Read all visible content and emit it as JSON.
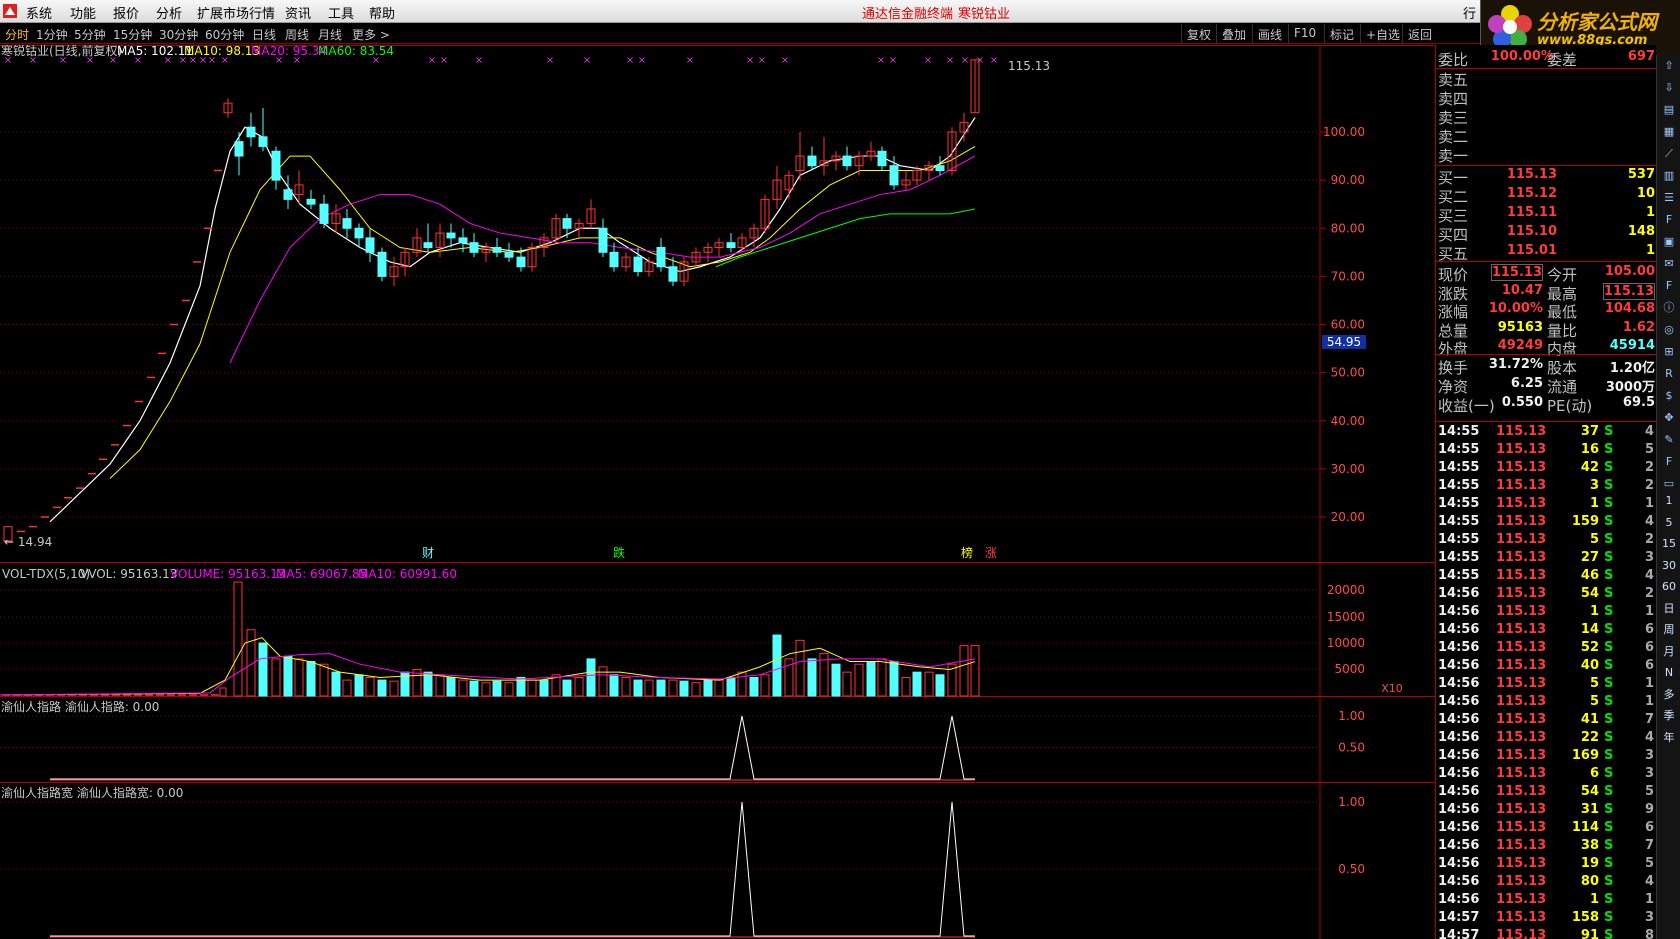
{
  "menu": {
    "items": [
      "系统",
      "功能",
      "报价",
      "分析",
      "扩展市场行情",
      "资讯",
      "工具",
      "帮助"
    ],
    "center_left": "通达信金融终端",
    "center_right": "寒锐钴业",
    "right_cut": "行"
  },
  "brand": {
    "name": "分析家公式网",
    "url": "www.88gs.com"
  },
  "periods": [
    "分时",
    "1分钟",
    "5分钟",
    "15分钟",
    "30分钟",
    "60分钟",
    "日线",
    "周线",
    "月线",
    "更多 >"
  ],
  "active_period": "分时",
  "toolbar_right": [
    "复权",
    "叠加",
    "画线",
    "F10",
    "标记",
    "+自选",
    "返回"
  ],
  "main": {
    "title": "寒锐钴业(日线,前复权)",
    "ma": [
      {
        "label": "MA5: 102.11",
        "color": "#ffffff"
      },
      {
        "label": "MA10: 98.13",
        "color": "#ffff00"
      },
      {
        "label": "MA20: 95.34",
        "color": "#ff00ff"
      },
      {
        "label": "MA60: 83.54",
        "color": "#00ff00"
      }
    ],
    "high_label": "115.13",
    "low_label": "14.94",
    "price_axis": [
      "100.00",
      "90.00",
      "80.00",
      "70.00",
      "60.00",
      "50.00",
      "40.00",
      "30.00",
      "20.00"
    ],
    "cursor_price": "54.95",
    "markers": [
      {
        "text": "财",
        "color": "#5fffff"
      },
      {
        "text": "跌",
        "color": "#00ff00"
      },
      {
        "text": "榜",
        "color": "#ffff00"
      },
      {
        "text": "涨",
        "color": "#ff4040"
      }
    ],
    "colors": {
      "up": "#ff3232",
      "down": "#54ffff",
      "ma5": "#ffffff",
      "ma10": "#ffff00",
      "ma20": "#ff00ff",
      "ma60": "#00ff00"
    }
  },
  "volume": {
    "header": [
      "VOL-TDX(5,10)",
      "VVOL: 95163.13",
      "VOLUME: 95163.13",
      "MA5: 69067.85",
      "MA10: 60991.60"
    ],
    "axis": [
      "20000",
      "15000",
      "10000",
      "5000"
    ],
    "unit": "X10"
  },
  "ind1": {
    "header": "渝仙人指路  渝仙人指路: 0.00",
    "axis": [
      "1.00",
      "0.50"
    ]
  },
  "ind2": {
    "header": "渝仙人指路宽  渝仙人指路宽: 0.00",
    "axis": [
      "1.00",
      "0.50"
    ]
  },
  "quote": {
    "weibi": {
      "label": "委比",
      "value": "100.00%",
      "label2": "委差",
      "value2": "697"
    },
    "sells": [
      {
        "label": "卖五"
      },
      {
        "label": "卖四"
      },
      {
        "label": "卖三"
      },
      {
        "label": "卖二"
      },
      {
        "label": "卖一"
      }
    ],
    "buys": [
      {
        "label": "买一",
        "price": "115.13",
        "vol": "537"
      },
      {
        "label": "买二",
        "price": "115.12",
        "vol": "10"
      },
      {
        "label": "买三",
        "price": "115.11",
        "vol": "1"
      },
      {
        "label": "买四",
        "price": "115.10",
        "vol": "148"
      },
      {
        "label": "买五",
        "price": "115.01",
        "vol": "1"
      }
    ],
    "stats": [
      {
        "l1": "现价",
        "v1": "115.13",
        "c1": "red",
        "l2": "今开",
        "v2": "105.00",
        "c2": "red"
      },
      {
        "l1": "涨跌",
        "v1": "10.47",
        "c1": "red",
        "l2": "最高",
        "v2": "115.13",
        "c2": "red"
      },
      {
        "l1": "涨幅",
        "v1": "10.00%",
        "c1": "red",
        "l2": "最低",
        "v2": "104.68",
        "c2": "red"
      },
      {
        "l1": "总量",
        "v1": "95163",
        "c1": "yel",
        "l2": "量比",
        "v2": "1.62",
        "c2": "red"
      },
      {
        "l1": "外盘",
        "v1": "49249",
        "c1": "red",
        "l2": "内盘",
        "v2": "45914",
        "c2": "cyan"
      },
      {
        "l1": "换手",
        "v1": "31.72%",
        "c1": "wht",
        "l2": "股本",
        "v2": "1.20亿",
        "c2": "wht"
      },
      {
        "l1": "净资",
        "v1": "6.25",
        "c1": "wht",
        "l2": "流通",
        "v2": "3000万",
        "c2": "wht"
      },
      {
        "l1": "收益(一)",
        "v1": "0.550",
        "c1": "wht",
        "l2": "PE(动)",
        "v2": "69.5",
        "c2": "wht"
      }
    ],
    "ticks": [
      {
        "time": "14:55",
        "price": "115.13",
        "vol": "37",
        "bs": "S",
        "n": "4"
      },
      {
        "time": "14:55",
        "price": "115.13",
        "vol": "16",
        "bs": "S",
        "n": "5"
      },
      {
        "time": "14:55",
        "price": "115.13",
        "vol": "42",
        "bs": "S",
        "n": "2"
      },
      {
        "time": "14:55",
        "price": "115.13",
        "vol": "3",
        "bs": "S",
        "n": "2"
      },
      {
        "time": "14:55",
        "price": "115.13",
        "vol": "1",
        "bs": "S",
        "n": "1"
      },
      {
        "time": "14:55",
        "price": "115.13",
        "vol": "159",
        "bs": "S",
        "n": "4"
      },
      {
        "time": "14:55",
        "price": "115.13",
        "vol": "5",
        "bs": "S",
        "n": "2"
      },
      {
        "time": "14:55",
        "price": "115.13",
        "vol": "27",
        "bs": "S",
        "n": "3"
      },
      {
        "time": "14:55",
        "price": "115.13",
        "vol": "46",
        "bs": "S",
        "n": "4"
      },
      {
        "time": "14:56",
        "price": "115.13",
        "vol": "54",
        "bs": "S",
        "n": "2"
      },
      {
        "time": "14:56",
        "price": "115.13",
        "vol": "1",
        "bs": "S",
        "n": "1"
      },
      {
        "time": "14:56",
        "price": "115.13",
        "vol": "14",
        "bs": "S",
        "n": "6"
      },
      {
        "time": "14:56",
        "price": "115.13",
        "vol": "52",
        "bs": "S",
        "n": "6"
      },
      {
        "time": "14:56",
        "price": "115.13",
        "vol": "40",
        "bs": "S",
        "n": "6"
      },
      {
        "time": "14:56",
        "price": "115.13",
        "vol": "5",
        "bs": "S",
        "n": "1"
      },
      {
        "time": "14:56",
        "price": "115.13",
        "vol": "5",
        "bs": "S",
        "n": "1"
      },
      {
        "time": "14:56",
        "price": "115.13",
        "vol": "41",
        "bs": "S",
        "n": "7"
      },
      {
        "time": "14:56",
        "price": "115.13",
        "vol": "22",
        "bs": "S",
        "n": "4"
      },
      {
        "time": "14:56",
        "price": "115.13",
        "vol": "169",
        "bs": "S",
        "n": "3"
      },
      {
        "time": "14:56",
        "price": "115.13",
        "vol": "6",
        "bs": "S",
        "n": "3"
      },
      {
        "time": "14:56",
        "price": "115.13",
        "vol": "54",
        "bs": "S",
        "n": "5"
      },
      {
        "time": "14:56",
        "price": "115.13",
        "vol": "31",
        "bs": "S",
        "n": "9"
      },
      {
        "time": "14:56",
        "price": "115.13",
        "vol": "114",
        "bs": "S",
        "n": "6"
      },
      {
        "time": "14:56",
        "price": "115.13",
        "vol": "38",
        "bs": "S",
        "n": "7"
      },
      {
        "time": "14:56",
        "price": "115.13",
        "vol": "19",
        "bs": "S",
        "n": "5"
      },
      {
        "time": "14:56",
        "price": "115.13",
        "vol": "80",
        "bs": "S",
        "n": "4"
      },
      {
        "time": "14:56",
        "price": "115.13",
        "vol": "1",
        "bs": "S",
        "n": "1"
      },
      {
        "time": "14:57",
        "price": "115.13",
        "vol": "158",
        "bs": "S",
        "n": "3"
      },
      {
        "time": "14:57",
        "price": "115.13",
        "vol": "91",
        "bs": "S",
        "n": "8"
      }
    ]
  },
  "sidebar_text": [
    "1",
    "5",
    "15",
    "30",
    "60",
    "日",
    "周",
    "月",
    "N",
    "多",
    "季",
    "年"
  ]
}
